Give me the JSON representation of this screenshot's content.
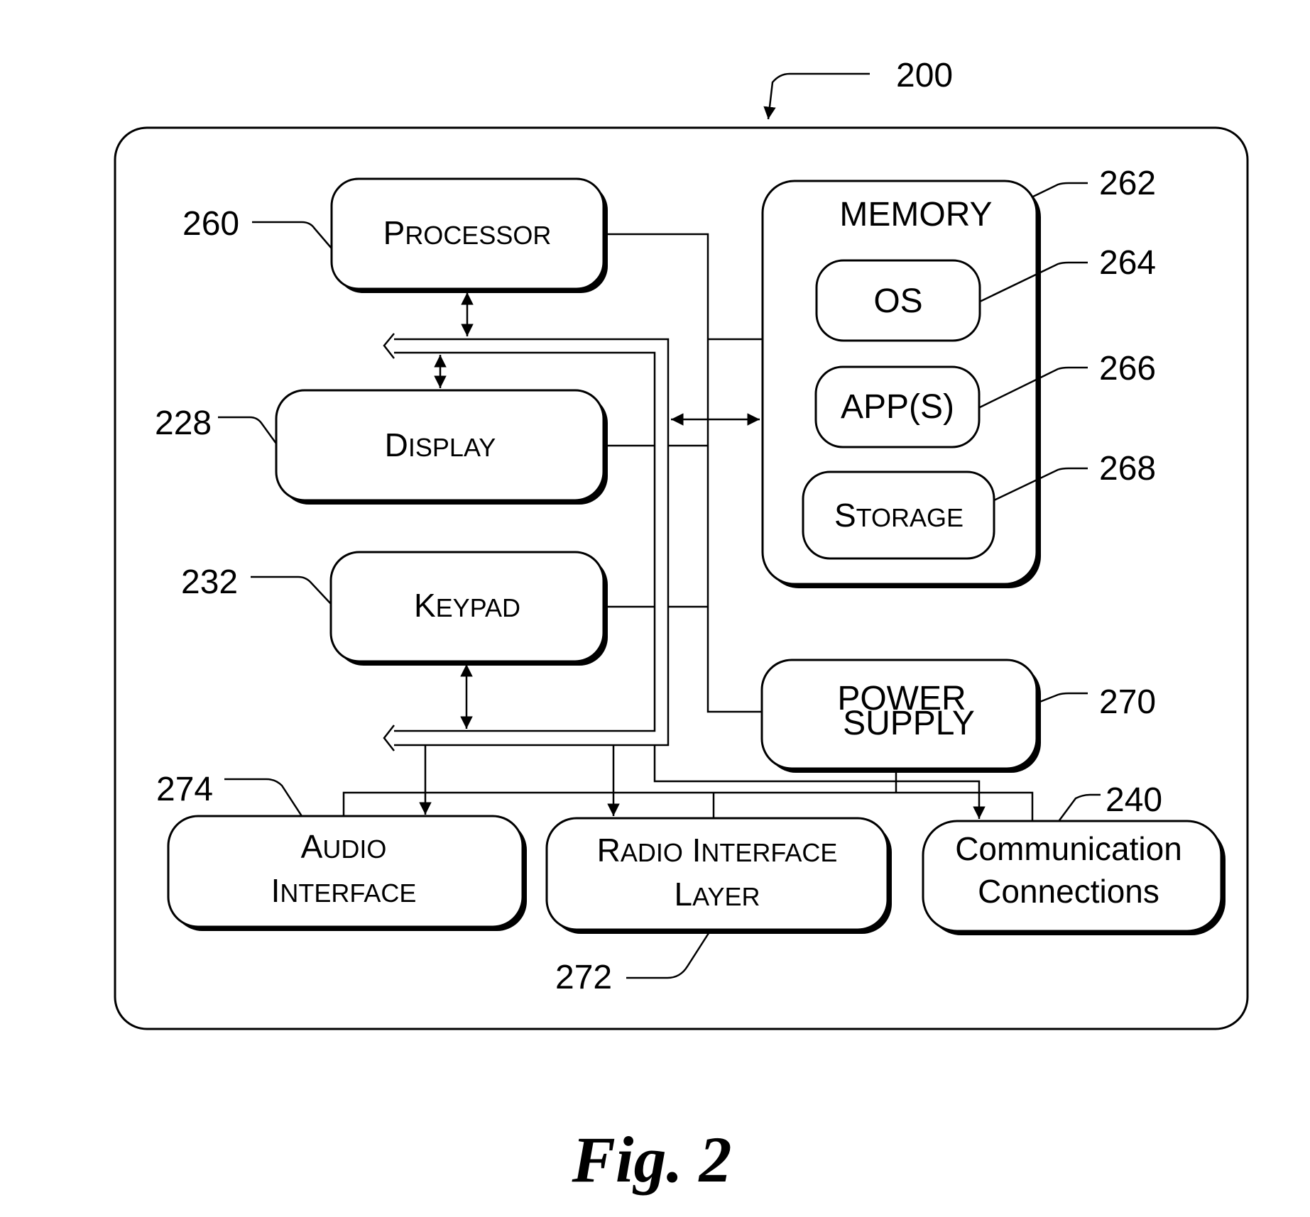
{
  "figure": {
    "caption": "Fig. 2",
    "reference": "200"
  },
  "blocks": {
    "processor": {
      "label_first": "P",
      "label_rest": "ROCESSOR",
      "ref": "260"
    },
    "memory": {
      "label": "MEMORY",
      "ref": "262"
    },
    "os": {
      "label": "OS",
      "ref": "264"
    },
    "apps": {
      "label": "APP(S)",
      "ref": "266"
    },
    "storage": {
      "label_first": "S",
      "label_rest": "TORAGE",
      "ref": "268"
    },
    "display": {
      "label_first": "D",
      "label_rest": "ISPLAY",
      "ref": "228"
    },
    "keypad": {
      "label_first": "K",
      "label_rest": "EYPAD",
      "ref": "232"
    },
    "power_supply": {
      "line1": "POWER",
      "line2": "SUPPLY",
      "ref": "270"
    },
    "audio_interface": {
      "line1_first": "A",
      "line1_rest": "UDIO",
      "line2_first": "I",
      "line2_rest": "NTERFACE",
      "ref": "274"
    },
    "radio_interface_layer": {
      "w1_first": "R",
      "w1_rest": "ADIO",
      "w2_first": "I",
      "w2_rest": "NTERFACE",
      "line2_first": "L",
      "line2_rest": "AYER",
      "ref": "272"
    },
    "communication_connections": {
      "line1": "Communication",
      "line2": "Connections",
      "ref": "240"
    }
  }
}
